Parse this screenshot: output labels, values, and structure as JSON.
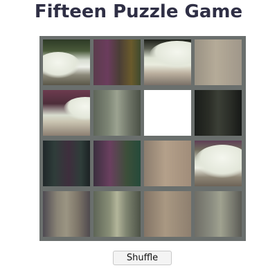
{
  "header": {
    "title": "Fifteen Puzzle Game"
  },
  "board": {
    "rows": 4,
    "cols": 4,
    "empty_position": {
      "row": 1,
      "col": 2
    },
    "frame_color": "#6a6f6d",
    "empty_color": "#ffffff"
  },
  "controls": {
    "shuffle_label": "Shuffle"
  }
}
